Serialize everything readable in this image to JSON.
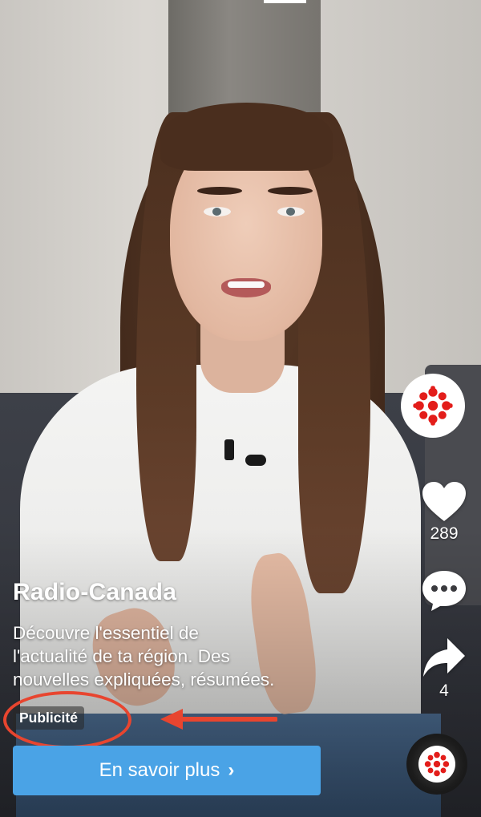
{
  "post": {
    "account_name": "Radio-Canada",
    "caption_lines": [
      "Découvre l'essentiel de",
      "l'actualité de ta région. Des",
      "nouvelles expliquées, résumées."
    ],
    "ad_label": "Publicité",
    "cta_label": "En savoir plus",
    "cta_chevron": "›"
  },
  "actions": {
    "like_count": "289",
    "share_count": "4"
  },
  "icons": {
    "profile": "cbc-gem-icon",
    "like": "heart-icon",
    "comment": "comment-bubble-icon",
    "share": "share-arrow-icon",
    "music": "cbc-gem-icon"
  },
  "colors": {
    "brand_red": "#e31d1a",
    "cta_blue": "#4aa3e6",
    "annotation_red": "#e8452f"
  }
}
